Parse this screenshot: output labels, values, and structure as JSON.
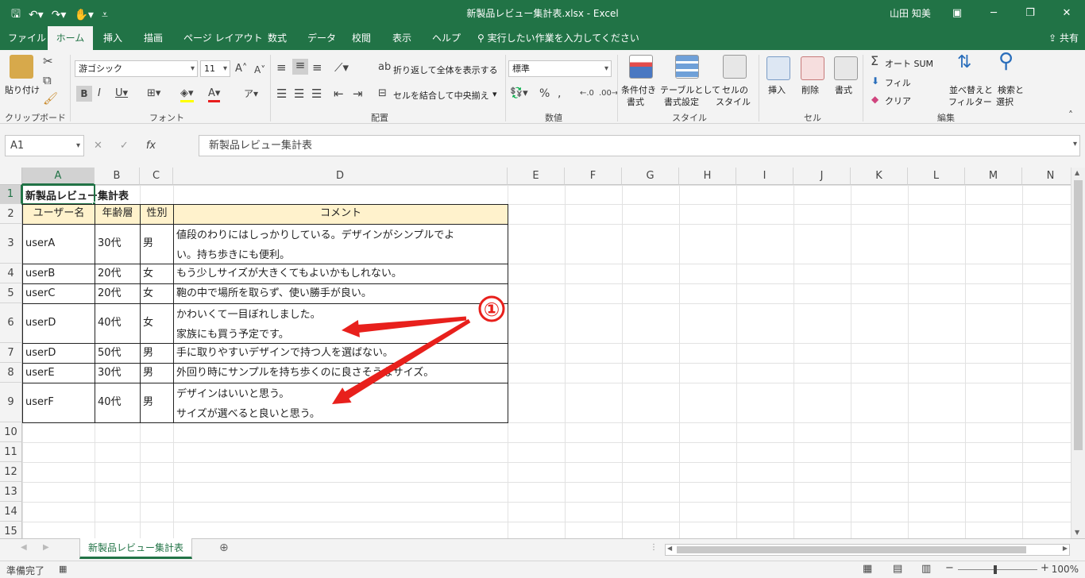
{
  "titlebar": {
    "title": "新製品レビュー集計表.xlsx - Excel",
    "user": "山田 知美"
  },
  "tabs": [
    "ファイル",
    "ホーム",
    "挿入",
    "描画",
    "ページ レイアウト",
    "数式",
    "データ",
    "校閲",
    "表示",
    "ヘルプ"
  ],
  "tell_me": "実行したい作業を入力してください",
  "share": "共有",
  "ribbon": {
    "paste": "貼り付け",
    "clipboard": "クリップボード",
    "font_name": "游ゴシック",
    "font_size": "11",
    "font_group": "フォント",
    "wrap_text": "折り返して全体を表示する",
    "merge_center": "セルを結合して中央揃え",
    "alignment_group": "配置",
    "number_format": "標準",
    "number_group": "数値",
    "conditional_1": "条件付き",
    "conditional_2": "書式",
    "table_1": "テーブルとして",
    "table_2": "書式設定",
    "cell_style_1": "セルの",
    "cell_style_2": "スタイル",
    "styles_group": "スタイル",
    "insert": "挿入",
    "delete": "削除",
    "format": "書式",
    "cells_group": "セル",
    "autosum": "オート SUM",
    "fill": "フィル",
    "clear": "クリア",
    "sort_1": "並べ替えと",
    "sort_2": "フィルター",
    "find_1": "検索と",
    "find_2": "選択",
    "editing_group": "編集"
  },
  "formula_bar": {
    "name_box": "A1",
    "content": "新製品レビュー集計表"
  },
  "columns": [
    "A",
    "B",
    "C",
    "D",
    "E",
    "F",
    "G",
    "H",
    "I",
    "J",
    "K",
    "L",
    "M",
    "N"
  ],
  "rows": [
    "1",
    "2",
    "3",
    "4",
    "5",
    "6",
    "7",
    "8",
    "9",
    "10",
    "11",
    "12",
    "13",
    "14",
    "15"
  ],
  "sheet": {
    "title": "新製品レビュー集計表",
    "headers": [
      "ユーザー名",
      "年齢層",
      "性別",
      "コメント"
    ],
    "records": [
      {
        "user": "userA",
        "age": "30代",
        "gender": "男",
        "comment1": "値段のわりにはしっかりしている。デザインがシンプルでよ",
        "comment2": "い。持ち歩きにも便利。"
      },
      {
        "user": "userB",
        "age": "20代",
        "gender": "女",
        "comment1": "もう少しサイズが大きくてもよいかもしれない。",
        "comment2": ""
      },
      {
        "user": "userC",
        "age": "20代",
        "gender": "女",
        "comment1": "鞄の中で場所を取らず、使い勝手が良い。",
        "comment2": ""
      },
      {
        "user": "userD",
        "age": "40代",
        "gender": "女",
        "comment1": "かわいくて一目ぼれしました。",
        "comment2": "家族にも買う予定です。"
      },
      {
        "user": "userD",
        "age": "50代",
        "gender": "男",
        "comment1": "手に取りやすいデザインで持つ人を選ばない。",
        "comment2": ""
      },
      {
        "user": "userE",
        "age": "30代",
        "gender": "男",
        "comment1": "外回り時にサンプルを持ち歩くのに良さそうなサイズ。",
        "comment2": ""
      },
      {
        "user": "userF",
        "age": "40代",
        "gender": "男",
        "comment1": "デザインはいいと思う。",
        "comment2": "サイズが選べると良いと思う。"
      }
    ]
  },
  "annotation": {
    "label": "①",
    "color": "#e8201c"
  },
  "sheet_tab": "新製品レビュー集計表",
  "status": {
    "ready": "準備完了",
    "zoom": "100%"
  },
  "colors": {
    "accent": "#217346",
    "header_fill": "#fff2cc"
  }
}
